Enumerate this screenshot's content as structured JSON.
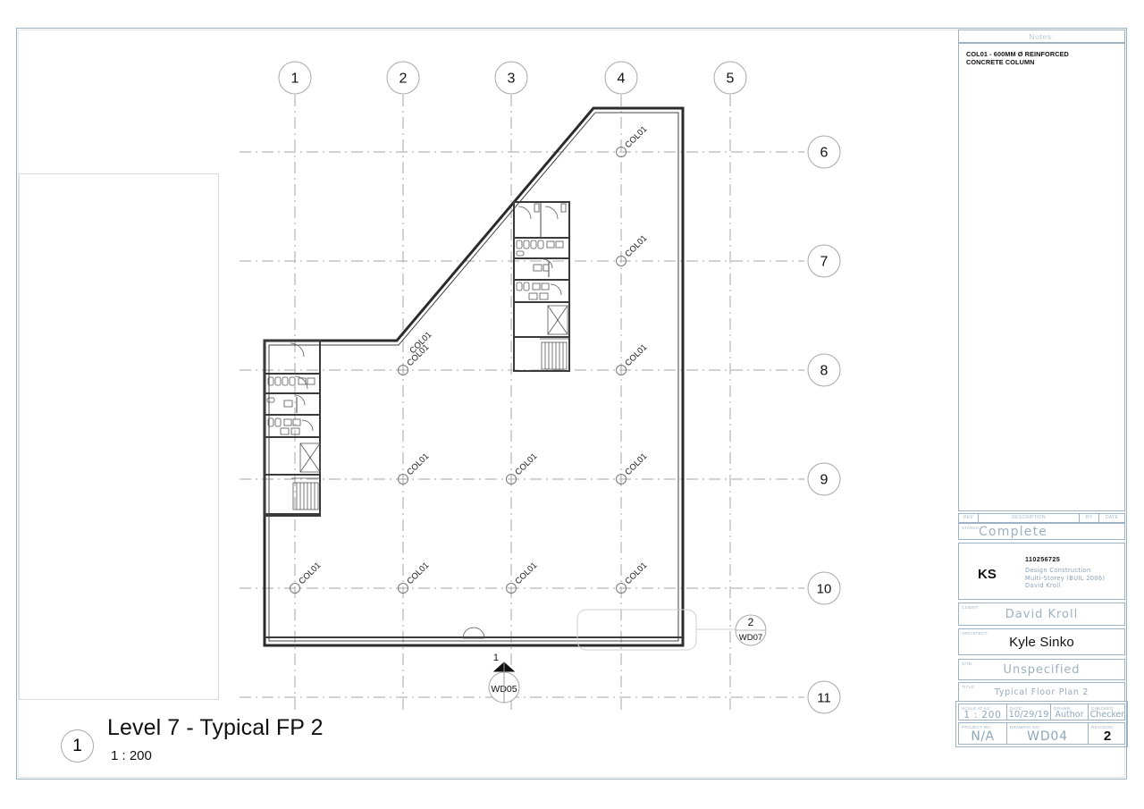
{
  "sheet": {
    "view_title": "Level 7 - Typical FP 2",
    "view_scale": "1 : 200",
    "view_bubble": "1"
  },
  "notes": {
    "header": "Notes:",
    "lines": [
      "COL01 - 600MM Ø REINFORCED",
      "CONCRETE COLUMN"
    ]
  },
  "revision_table": {
    "headers": [
      "REV",
      "DESCRIPTION",
      "BY",
      "DATE"
    ],
    "rows": []
  },
  "title_block": {
    "status_label": "STATUS:",
    "status_value": "Complete",
    "project_initials": "KS",
    "project_number_text": "110256725",
    "project_lines": [
      "Design Construction",
      "Multi-Storey (BUIL 2006)",
      "David Kroll"
    ],
    "client_label": "CLIENT:",
    "client_value": "David  Kroll",
    "architect_label": "ARCHITECT:",
    "architect_value": "Kyle Sinko",
    "site_label": "SITE:",
    "site_value": "Unspecified",
    "title_label": "TITLE:",
    "title_value": "Typical Floor Plan 2",
    "scale_label": "SCALE AT A3:",
    "scale_value": "1 : 200",
    "date_label": "DATE:",
    "date_value": "10/29/19",
    "drawn_label": "DRAWN:",
    "drawn_value": "Author",
    "checked_label": "CHECKED:",
    "checked_value": "Checker",
    "project_no_label": "PROJECT NO:",
    "project_no_value": "N/A",
    "drawing_no_label": "DRAWING NO:",
    "drawing_no_value": "WD04",
    "revision_label": "REVISION:",
    "revision_value": "2"
  },
  "plan": {
    "grid_top_bubbles": [
      "1",
      "2",
      "3",
      "4",
      "5"
    ],
    "grid_right_bubbles": [
      "6",
      "7",
      "8",
      "9",
      "10",
      "11"
    ],
    "column_tag": "COL01",
    "column_tag_count": 12,
    "section_markers": [
      {
        "number": "1",
        "sheet": "WD05"
      },
      {
        "number": "2",
        "sheet": "WD07"
      }
    ]
  },
  "colors": {
    "frame_blue": "#9bb0c2",
    "text_blue": "#9db0c2",
    "grid_gray": "#9a9a9a",
    "wall_dark": "#333333",
    "paper_white": "#ffffff"
  }
}
